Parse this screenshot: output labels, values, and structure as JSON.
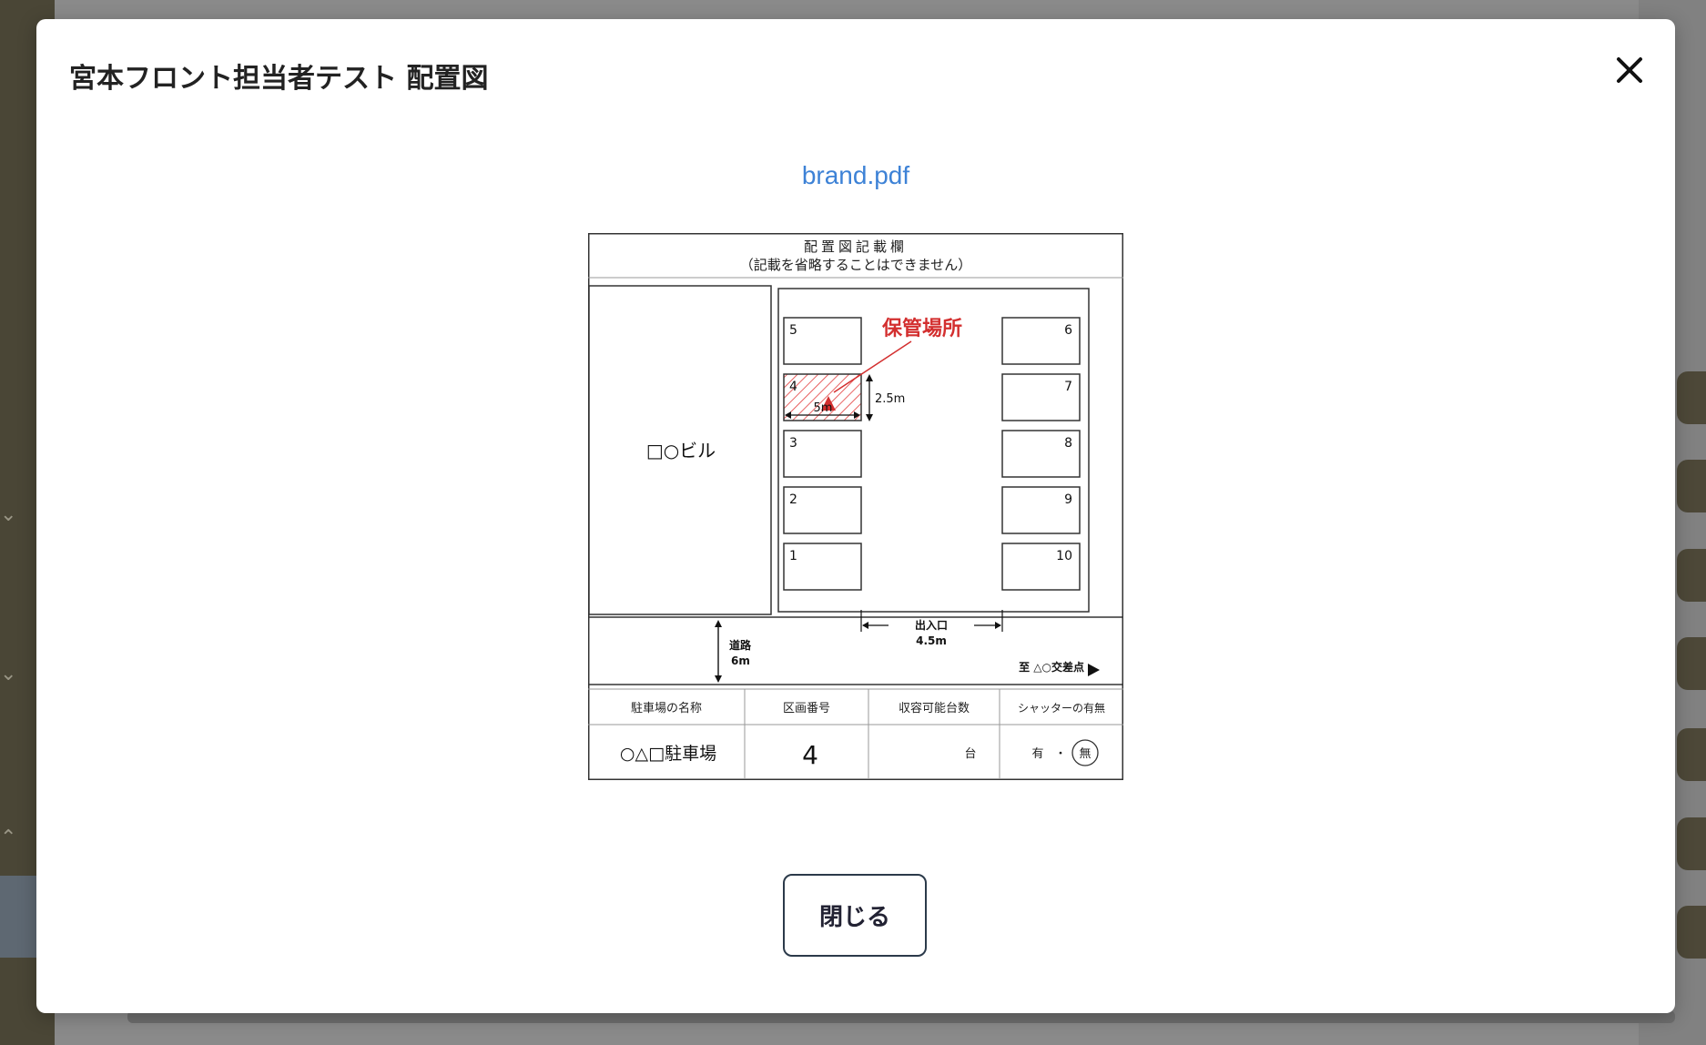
{
  "modal": {
    "title": "宮本フロント担当者テスト 配置図",
    "file_name": "brand.pdf",
    "close_button_label": "閉じる"
  },
  "document": {
    "heading": "配置図記載欄",
    "subheading": "（記載を省略することはできません）",
    "building_label": "□○ビル",
    "storage_label": "保管場所",
    "width_label": "5m",
    "depth_label": "2.5m",
    "left_spaces": [
      "5",
      "4",
      "3",
      "2",
      "1"
    ],
    "right_spaces": [
      "6",
      "7",
      "8",
      "9",
      "10"
    ],
    "entrance_label": "出入口",
    "entrance_width": "4.5m",
    "road_label": "道路",
    "road_width": "6m",
    "direction_label": "至 △○交差点",
    "table": {
      "headers": [
        "駐車場の名称",
        "区画番号",
        "収容可能台数",
        "シャッターの有無"
      ],
      "parking_name": "○△□駐車場",
      "space_number": "4",
      "capacity_unit": "台",
      "shutter_yes": "有",
      "shutter_dot": "・",
      "shutter_no": "無"
    }
  }
}
